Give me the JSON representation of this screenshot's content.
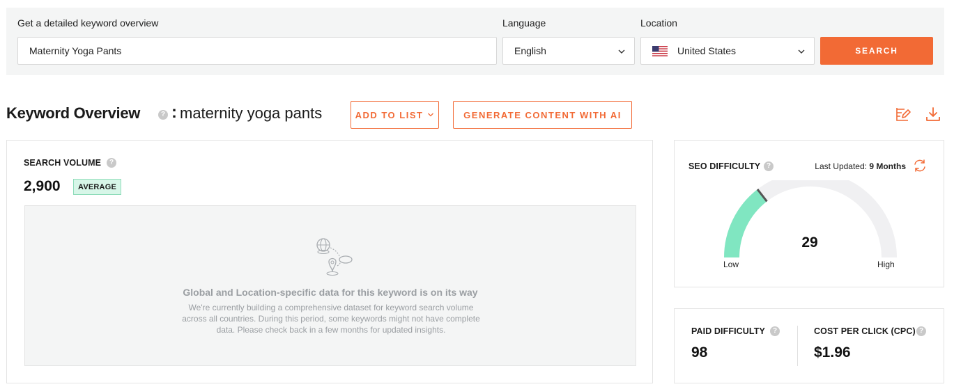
{
  "search": {
    "keyword_label": "Get a detailed keyword overview",
    "keyword_value": "Maternity Yoga Pants",
    "language_label": "Language",
    "language_value": "English",
    "location_label": "Location",
    "location_value": "United States",
    "search_button": "SEARCH"
  },
  "overview": {
    "title": "Keyword Overview",
    "colon": ":",
    "keyword": "maternity yoga pants",
    "add_to_list": "ADD TO LIST",
    "generate_ai": "GENERATE CONTENT WITH AI"
  },
  "search_volume": {
    "label": "SEARCH VOLUME",
    "value": "2,900",
    "badge": "AVERAGE",
    "placeholder_title": "Global and Location-specific data for this keyword is on its way",
    "placeholder_text": "We're currently building a comprehensive dataset for keyword search volume across all countries. During this period, some keywords might not have complete data. Please check back in a few months for updated insights."
  },
  "seo_difficulty": {
    "label": "SEO DIFFICULTY",
    "last_updated_label": "Last Updated:",
    "last_updated_value": "9 Months",
    "value": "29",
    "level": 0.29,
    "low_label": "Low",
    "high_label": "High"
  },
  "paid_difficulty": {
    "label": "PAID DIFFICULTY",
    "value": "98"
  },
  "cpc": {
    "label": "COST PER CLICK (CPC)",
    "value": "$1.96"
  },
  "colors": {
    "accent": "#f26a35",
    "gauge_fill": "#80e6c1",
    "gauge_track": "#f0f0f2",
    "badge_bg": "#d7f6e8"
  },
  "icons": {
    "help": "help-icon",
    "chevron": "chevron-down-icon",
    "flag": "us-flag-icon",
    "edit": "edit-list-icon",
    "download": "download-icon",
    "refresh": "refresh-icon",
    "placeholder": "globe-location-icon"
  }
}
